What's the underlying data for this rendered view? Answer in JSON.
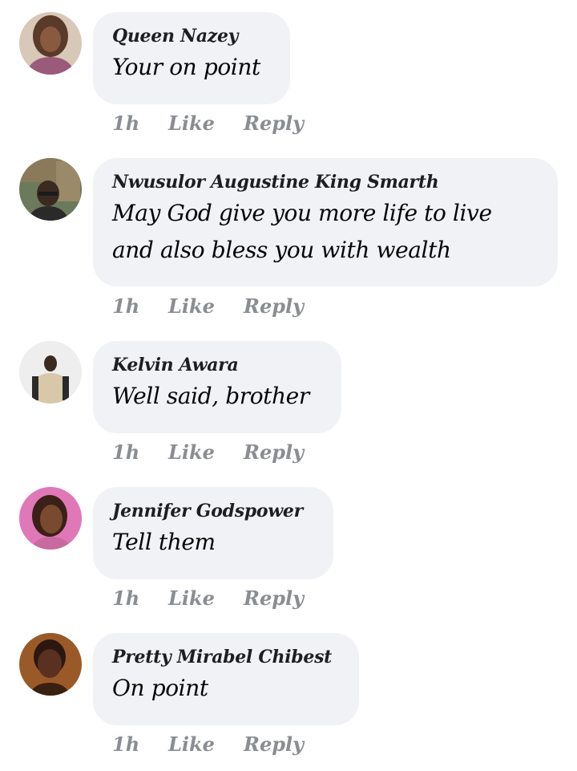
{
  "comments": [
    {
      "author": "Queen Nazey",
      "text_lines": [
        "Your on point"
      ],
      "time": "1h",
      "like_label": "Like",
      "reply_label": "Reply",
      "avatar_colors": [
        "#7a4a3a",
        "#c48a6a"
      ]
    },
    {
      "author": "Nwusulor Augustine King Smarth",
      "text_lines": [
        "May God give you more life to live",
        "and also bless you with wealth"
      ],
      "time": "1h",
      "like_label": "Like",
      "reply_label": "Reply",
      "avatar_colors": [
        "#4a5a3a",
        "#2a2a2a"
      ]
    },
    {
      "author": "Kelvin Awara",
      "text_lines": [
        "Well said, brother"
      ],
      "time": "1h",
      "like_label": "Like",
      "reply_label": "Reply",
      "avatar_colors": [
        "#e8e8e8",
        "#3a2a20"
      ]
    },
    {
      "author": "Jennifer Godspower",
      "text_lines": [
        "Tell them"
      ],
      "time": "1h",
      "like_label": "Like",
      "reply_label": "Reply",
      "avatar_colors": [
        "#e070b0",
        "#6a3a2a"
      ]
    },
    {
      "author": "Pretty Mirabel Chibest",
      "text_lines": [
        "On point"
      ],
      "time": "1h",
      "like_label": "Like",
      "reply_label": "Reply",
      "avatar_colors": [
        "#8a4a20",
        "#3a2010"
      ]
    }
  ]
}
